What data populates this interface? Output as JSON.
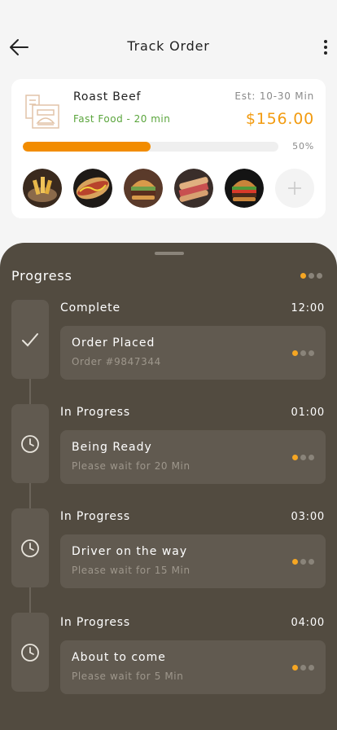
{
  "header": {
    "title": "Track Order",
    "back_icon": "arrow-left-icon",
    "menu_icon": "more-vertical-icon"
  },
  "order": {
    "name": "Roast Beef",
    "category": "Fast Food - 20 min",
    "estimate": "Est: 10-30 Min",
    "price": "$156.00",
    "progress_percent": 50,
    "progress_label": "50%",
    "photos": [
      "fries-photo",
      "hotdog-photo",
      "burger-photo",
      "sandwich-photo",
      "cheeseburger-photo"
    ],
    "add_icon": "plus-icon"
  },
  "colors": {
    "accent": "#f28c00",
    "price": "#f29b10",
    "green": "#5aa53c",
    "sheet": "#524b40",
    "card": "#615a50"
  },
  "progress": {
    "title": "Progress",
    "steps": [
      {
        "status": "Complete",
        "time": "12:00",
        "title": "Order Placed",
        "detail": "Order #9847344",
        "icon": "check-icon"
      },
      {
        "status": "In Progress",
        "time": "01:00",
        "title": "Being Ready",
        "detail": "Please wait for 20 Min",
        "icon": "clock-icon"
      },
      {
        "status": "In Progress",
        "time": "03:00",
        "title": "Driver on the way",
        "detail": "Please wait for 15 Min",
        "icon": "clock-icon"
      },
      {
        "status": "In Progress",
        "time": "04:00",
        "title": "About to come",
        "detail": "Please wait for 5 Min",
        "icon": "clock-icon"
      }
    ]
  }
}
